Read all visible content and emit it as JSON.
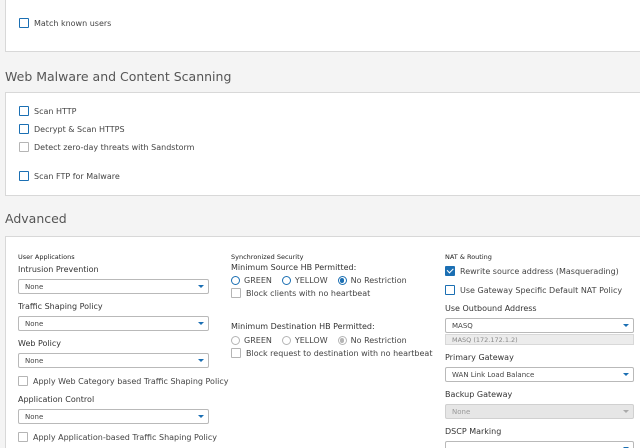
{
  "top_panel": {
    "match_known_users": {
      "label": "Match known users",
      "checked": false
    }
  },
  "web_malware": {
    "title": "Web Malware and Content Scanning",
    "scan_http": {
      "label": "Scan HTTP",
      "checked": false
    },
    "decrypt_scan_https": {
      "label": "Decrypt & Scan HTTPS",
      "checked": false
    },
    "sandstorm": {
      "label": "Detect zero-day threats with Sandstorm",
      "checked": false,
      "disabled": true
    },
    "scan_ftp": {
      "label": "Scan FTP for Malware",
      "checked": false
    }
  },
  "advanced": {
    "title": "Advanced",
    "user_applications": {
      "heading": "User Applications",
      "intrusion_prevention": {
        "label": "Intrusion Prevention",
        "value": "None"
      },
      "traffic_shaping": {
        "label": "Traffic Shaping Policy",
        "value": "None"
      },
      "web_policy": {
        "label": "Web Policy",
        "value": "None"
      },
      "apply_web_category": {
        "label": "Apply Web Category based Traffic Shaping Policy",
        "checked": false
      },
      "application_control": {
        "label": "Application Control",
        "value": "None"
      },
      "apply_app_based": {
        "label": "Apply Application-based Traffic Shaping Policy",
        "checked": false
      }
    },
    "sync_security": {
      "heading": "Synchronized Security",
      "min_source_label": "Minimum Source HB Permitted:",
      "source_options": [
        "GREEN",
        "YELLOW",
        "No Restriction"
      ],
      "source_selected": "No Restriction",
      "block_clients": {
        "label": "Block clients with no heartbeat",
        "checked": false
      },
      "min_dest_label": "Minimum Destination HB Permitted:",
      "dest_options": [
        "GREEN",
        "YELLOW",
        "No Restriction"
      ],
      "dest_selected": "No Restriction",
      "block_request": {
        "label": "Block request to destination with no heartbeat",
        "checked": false
      }
    },
    "nat_routing": {
      "heading": "NAT & Routing",
      "rewrite_source": {
        "label": "Rewrite source address (Masquerading)",
        "checked": true
      },
      "gateway_specific": {
        "label": "Use Gateway Specific Default NAT Policy",
        "checked": false
      },
      "outbound_address": {
        "label": "Use Outbound Address",
        "value": "MASQ",
        "subtext": "MASQ (172.172.1.2)"
      },
      "primary_gateway": {
        "label": "Primary Gateway",
        "value": "WAN Link Load Balance"
      },
      "backup_gateway": {
        "label": "Backup Gateway",
        "value": "None"
      },
      "dscp_marking": {
        "label": "DSCP Marking"
      }
    }
  },
  "colors": {
    "accent": "#1b6fb3",
    "panel_bg": "#ffffff",
    "page_bg": "#f4f4f4"
  }
}
